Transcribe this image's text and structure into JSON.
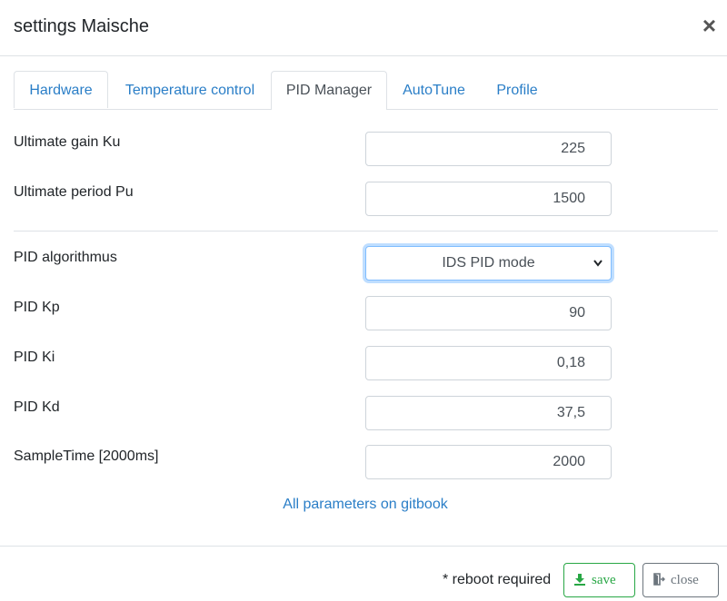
{
  "modal": {
    "title": "settings Maische",
    "close_glyph": "×"
  },
  "tabs": [
    {
      "label": "Hardware",
      "active": false
    },
    {
      "label": "Temperature control",
      "active": false
    },
    {
      "label": "PID Manager",
      "active": true
    },
    {
      "label": "AutoTune",
      "active": false
    },
    {
      "label": "Profile",
      "active": false
    }
  ],
  "fields": {
    "ultimate_gain": {
      "label": "Ultimate gain Ku",
      "value": "225"
    },
    "ultimate_period": {
      "label": "Ultimate period Pu",
      "value": "1500"
    },
    "pid_algorithm": {
      "label": "PID algorithmus",
      "value": "IDS PID mode"
    },
    "pid_kp": {
      "label": "PID Kp",
      "value": "90"
    },
    "pid_ki": {
      "label": "PID Ki",
      "value": "0,18"
    },
    "pid_kd": {
      "label": "PID Kd",
      "value": "37,5"
    },
    "sample_time": {
      "label": "SampleTime [2000ms]",
      "value": "2000"
    }
  },
  "link": {
    "label": "All parameters on gitbook"
  },
  "footer": {
    "note": "* reboot required",
    "save_label": "save",
    "close_label": "close"
  },
  "icons": {
    "save": "download-icon",
    "close": "exit-door-icon",
    "select": "chevron-down-icon"
  },
  "colors": {
    "link": "#2a7ec7",
    "save": "#28a745",
    "close": "#6c757d",
    "focus": "#80bdff"
  }
}
